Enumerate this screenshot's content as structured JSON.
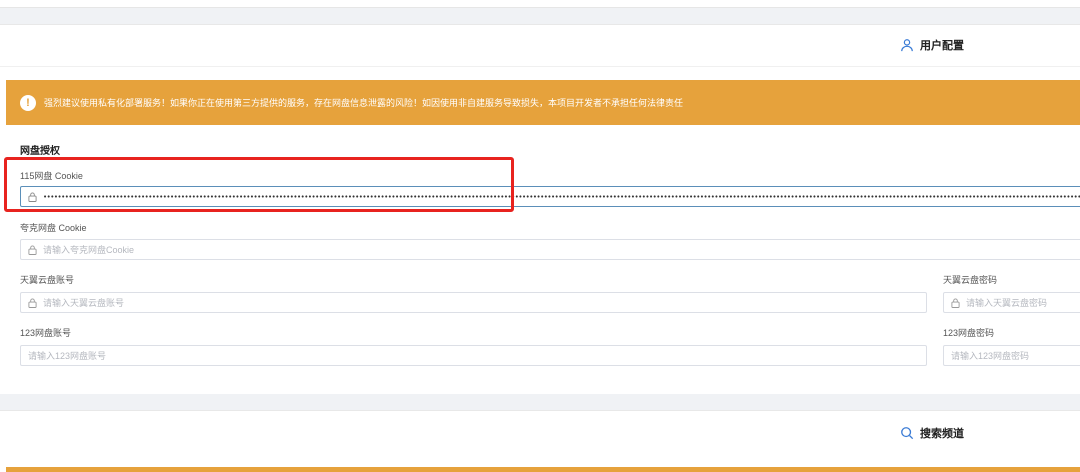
{
  "user_config": {
    "title": "用户配置",
    "icon": "user-icon"
  },
  "warning": {
    "icon": "exclamation-icon",
    "text": "强烈建议使用私有化部署服务！如果你正在使用第三方提供的服务，存在网盘信息泄露的风险！如因使用非自建服务导致损失，本项目开发者不承担任何法律责任"
  },
  "disk_auth": {
    "section_title": "网盘授权",
    "cookie_115": {
      "label": "115网盘 Cookie",
      "value": "••••••••••••••••••••••••••••••••••••••••••••••••••••••••••••••••••••••••••••••••••••••••••••••••••••••••••••••••••••••••••••••••••••••••••••••••••••••••••••••••••••••••••••••••••••••••••••••••••••••••••••••••••••••••••••••••••••••••••••••••••••••••••••••••••••••••••••••••••••••••••••••••••••••••••••••••••••••••••••••••••"
    },
    "quark_cookie": {
      "label": "夸克网盘 Cookie",
      "placeholder": "请输入夸克网盘Cookie"
    },
    "tianyi_account": {
      "label": "天翼云盘账号",
      "placeholder": "请输入天翼云盘账号"
    },
    "tianyi_password": {
      "label": "天翼云盘密码",
      "placeholder": "请输入天翼云盘密码"
    },
    "pan123_account": {
      "label": "123网盘账号",
      "placeholder": "请输入123网盘账号"
    },
    "pan123_password": {
      "label": "123网盘密码",
      "placeholder": "请输入123网盘密码"
    }
  },
  "search_channels": {
    "title": "搜索频道",
    "icon": "search-icon"
  },
  "colors": {
    "warning": "#e6a23c",
    "highlight_box": "#e8231f",
    "focus_border": "#5b8fb9"
  }
}
